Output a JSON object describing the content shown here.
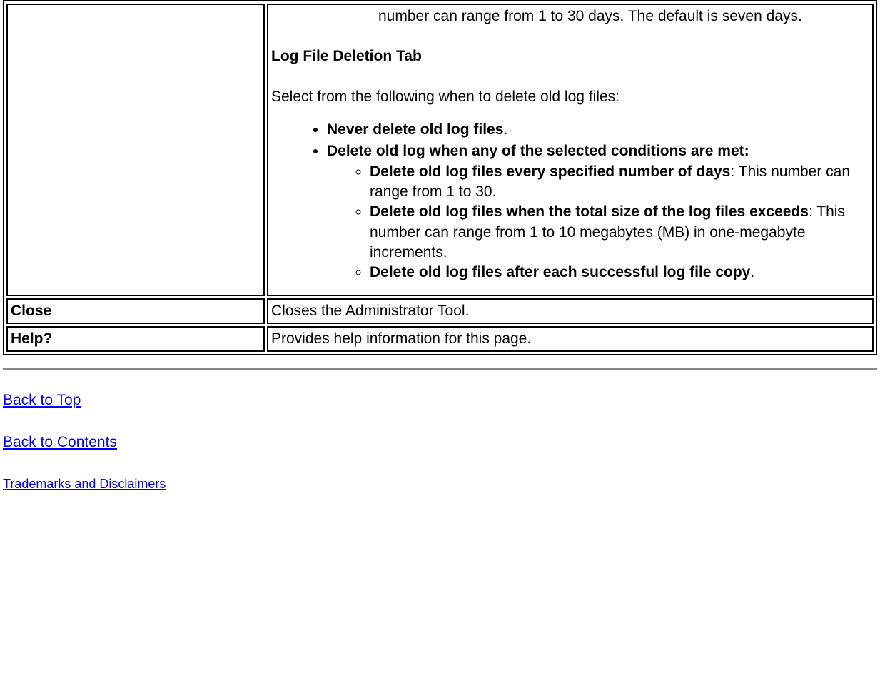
{
  "cell_main": {
    "fragment": "number can range from 1 to 30 days. The default is seven days.",
    "heading": "Log File Deletion Tab",
    "intro": "Select from the following when to delete old log files:",
    "bullets": {
      "b1": "Never delete old log files",
      "b1_suffix": ".",
      "b2": "Delete old log when any of the selected conditions are met:",
      "sub1_bold": "Delete old log files every specified number of days",
      "sub1_rest": ": This number can range from 1 to 30.",
      "sub2_bold": "Delete old log files when the total size of the log files exceeds",
      "sub2_rest": ": This number can range from 1 to 10 megabytes (MB) in one-megabyte increments.",
      "sub3_bold": "Delete old log files after each successful log file copy",
      "sub3_suffix": "."
    }
  },
  "row_close": {
    "label": "Close",
    "desc": "Closes the Administrator Tool."
  },
  "row_help": {
    "label": "Help?",
    "desc": "Provides help information for this page."
  },
  "links": {
    "back_top": "Back to Top",
    "back_contents": "Back to Contents",
    "trademarks": "Trademarks and Disclaimers"
  }
}
